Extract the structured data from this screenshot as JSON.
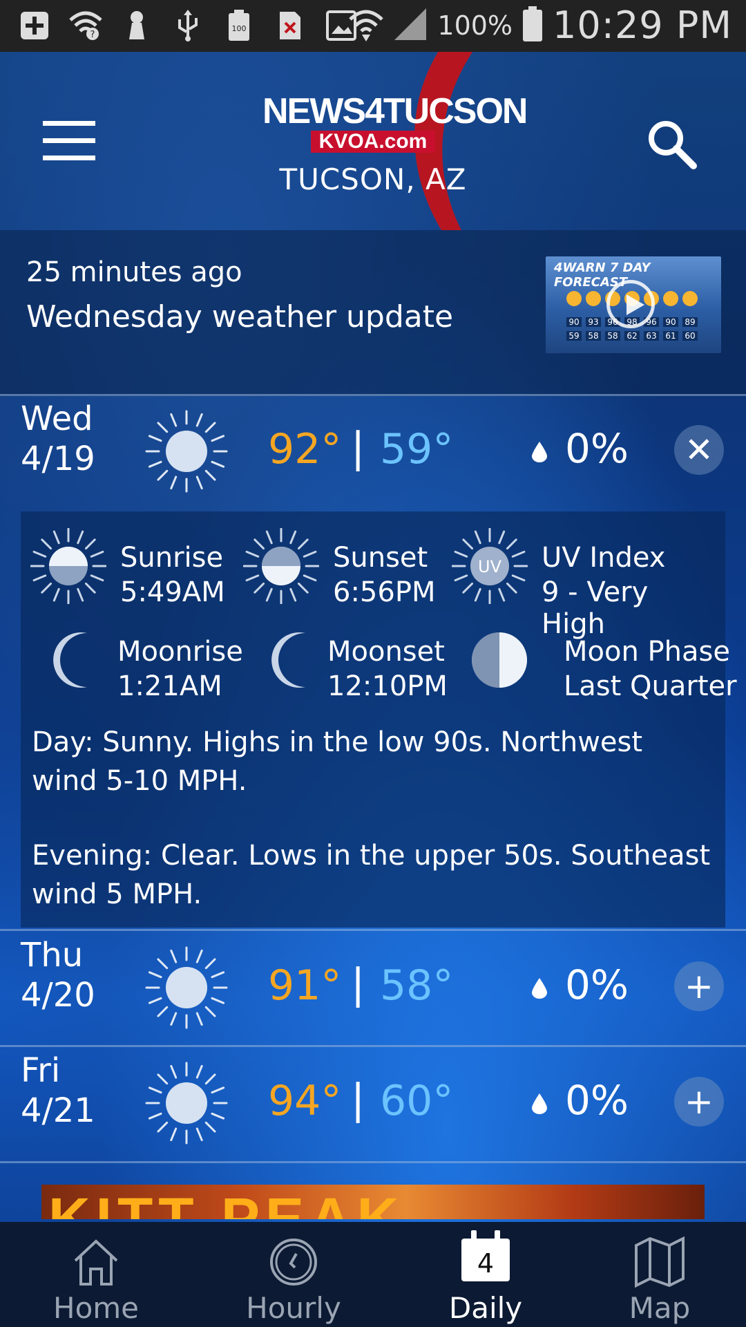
{
  "status_bar": {
    "battery_percent": "100%",
    "time": "10:29 PM",
    "icons": [
      "plus-icon",
      "wifi-question-icon",
      "keyhole-icon",
      "usb-icon",
      "battery-100-icon",
      "no-sim-icon",
      "image-icon",
      "wifi-icon",
      "signal-icon",
      "battery-icon"
    ]
  },
  "header": {
    "logo_line1": "NEWS4TUCSON",
    "logo_line2": "KVOA.com",
    "location": "TUCSON, AZ"
  },
  "news": {
    "time_ago": "25 minutes ago",
    "title": "Wednesday weather update",
    "thumb_label": "4WARN 7 DAY FORECAST",
    "thumb_temps_high": [
      "90",
      "93",
      "96",
      "98",
      "96",
      "90",
      "89"
    ],
    "thumb_temps_low": [
      "59",
      "58",
      "58",
      "62",
      "63",
      "61",
      "60"
    ]
  },
  "days": [
    {
      "name": "Wed",
      "date": "4/19",
      "high": "92°",
      "low": "59°",
      "precip": "0%",
      "toggle": "✕",
      "expanded": true,
      "icon": "sunny-icon"
    },
    {
      "name": "Thu",
      "date": "4/20",
      "high": "91°",
      "low": "58°",
      "precip": "0%",
      "toggle": "+",
      "expanded": false,
      "icon": "sunny-icon"
    },
    {
      "name": "Fri",
      "date": "4/21",
      "high": "94°",
      "low": "60°",
      "precip": "0%",
      "toggle": "+",
      "expanded": false,
      "icon": "sunny-icon"
    }
  ],
  "separator": "|",
  "detail": {
    "sunrise": {
      "label": "Sunrise",
      "value": "5:49AM"
    },
    "sunset": {
      "label": "Sunset",
      "value": "6:56PM"
    },
    "uv": {
      "label": "UV Index",
      "value": "9 - Very High",
      "badge": "UV"
    },
    "moonrise": {
      "label": "Moonrise",
      "value": "1:21AM"
    },
    "moonset": {
      "label": "Moonset",
      "value": "12:10PM"
    },
    "moon_phase": {
      "label": "Moon Phase",
      "value": "Last Quarter"
    },
    "day_text": "Day: Sunny. Highs in the low 90s. Northwest wind 5-10 MPH.",
    "evening_text": "Evening: Clear. Lows in the upper 50s. Southeast wind 5 MPH."
  },
  "ad": {
    "text": "KITT PEAK"
  },
  "nav": {
    "items": [
      {
        "label": "Home",
        "icon": "home-icon",
        "active": false
      },
      {
        "label": "Hourly",
        "icon": "clock-icon",
        "active": false
      },
      {
        "label": "Daily",
        "icon": "calendar-icon",
        "active": true,
        "badge": "4"
      },
      {
        "label": "Map",
        "icon": "map-icon",
        "active": false
      }
    ]
  },
  "colors": {
    "high_temp": "#f5a623",
    "low_temp": "#6cc3ff",
    "brand_red": "#c0141c",
    "navbar": "#0c1a33"
  }
}
